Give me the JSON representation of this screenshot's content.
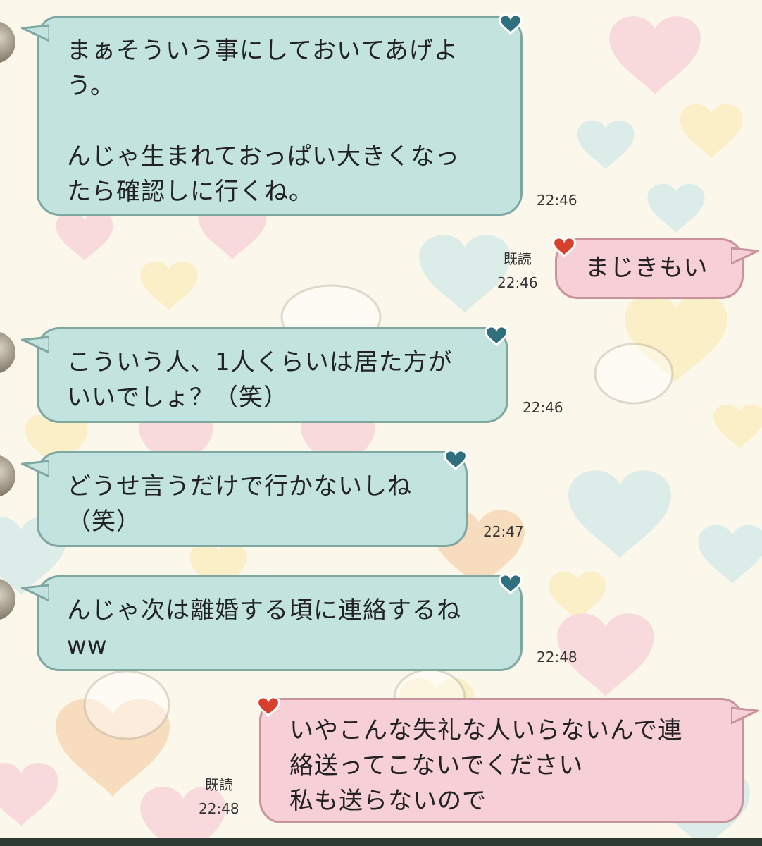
{
  "messages": [
    {
      "side": "in",
      "text": "まぁそういう事にしておいてあげよ\nう。\n\nんじゃ生まれておっぱい大きくなっ\nたら確認しに行くね。",
      "time": "22:46"
    },
    {
      "side": "out",
      "text": "まじきもい",
      "read": "既読",
      "time": "22:46"
    },
    {
      "side": "in",
      "text": "こういう人、1人くらいは居た方が\nいいでしょ？（笑）",
      "time": "22:46"
    },
    {
      "side": "in",
      "text": "どうせ言うだけで行かないしね\n（笑）",
      "time": "22:47"
    },
    {
      "side": "in",
      "text": "んじゃ次は離婚する頃に連絡するね\nww",
      "time": "22:48"
    },
    {
      "side": "out",
      "text": "いやこんな失礼な人いらないんで連\n絡送ってこないでください\n私も送らないので",
      "read": "既読",
      "time": "22:48"
    }
  ],
  "colors": {
    "incoming_bubble": "#c2e3de",
    "outgoing_bubble": "#f7cfd6",
    "incoming_heart": "#2f6f7e",
    "outgoing_heart": "#d8402e"
  },
  "icons": {
    "incoming_heart": "heart-icon",
    "outgoing_heart": "heart-icon",
    "avatar": "avatar"
  }
}
